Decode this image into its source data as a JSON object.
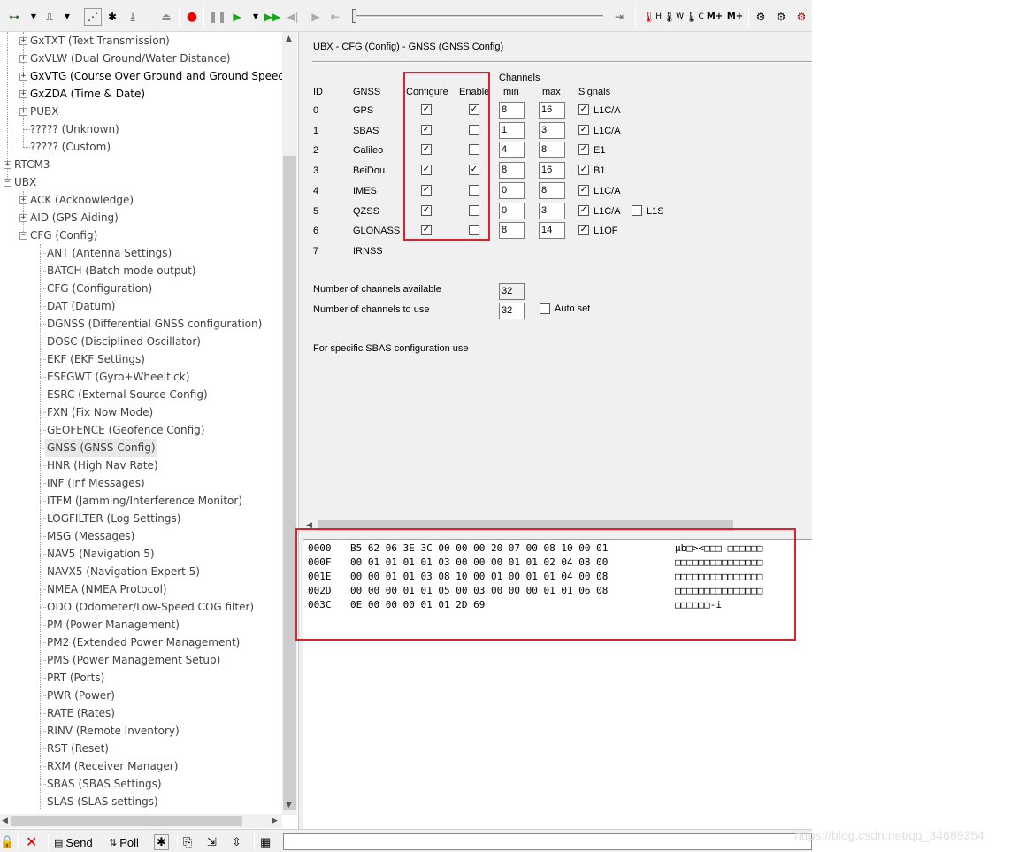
{
  "toolbar": {
    "icons": [
      "connect-icon",
      "baud-icon",
      "wizard-icon",
      "debug-icon",
      "download-icon",
      "eject-icon",
      "record-icon",
      "pause-icon",
      "play-icon",
      "fast-forward-icon",
      "step-back-icon",
      "step-forward-icon",
      "skip-start-icon",
      "skip-end-icon",
      "hot-start-icon",
      "warm-start-icon",
      "cold-start-icon",
      "msg-add-icon",
      "msg-remove-icon",
      "settings-icon",
      "settings-2-icon",
      "settings-3-icon"
    ],
    "labels": {
      "hot": "H",
      "warm": "W",
      "cold": "C"
    }
  },
  "tree": {
    "items": [
      {
        "label": "GxTXT (Text Transmission)",
        "exp": "+"
      },
      {
        "label": "GxVLW (Dual Ground/Water Distance)",
        "exp": "+"
      },
      {
        "label": "GxVTG (Course Over Ground and Ground Speed)",
        "exp": "+"
      },
      {
        "label": "GxZDA (Time & Date)",
        "exp": "+"
      },
      {
        "label": "PUBX",
        "exp": "+"
      },
      {
        "label": "????? (Unknown)",
        "exp": ""
      },
      {
        "label": "????? (Custom)",
        "exp": ""
      },
      {
        "label": "RTCM3",
        "exp": "+"
      },
      {
        "label": "UBX",
        "exp": "−"
      },
      {
        "label": "ACK (Acknowledge)",
        "exp": "+"
      },
      {
        "label": "AID (GPS Aiding)",
        "exp": "+"
      },
      {
        "label": "CFG (Config)",
        "exp": "−"
      },
      {
        "label": "ANT (Antenna Settings)"
      },
      {
        "label": "BATCH (Batch mode output)"
      },
      {
        "label": "CFG (Configuration)"
      },
      {
        "label": "DAT (Datum)"
      },
      {
        "label": "DGNSS (Differential GNSS configuration)"
      },
      {
        "label": "DOSC (Disciplined Oscillator)"
      },
      {
        "label": "EKF (EKF Settings)"
      },
      {
        "label": "ESFGWT (Gyro+Wheeltick)"
      },
      {
        "label": "ESRC (External Source Config)"
      },
      {
        "label": "FXN (Fix Now Mode)"
      },
      {
        "label": "GEOFENCE (Geofence Config)"
      },
      {
        "label": "GNSS (GNSS Config)"
      },
      {
        "label": "HNR (High Nav Rate)"
      },
      {
        "label": "INF (Inf Messages)"
      },
      {
        "label": "ITFM (Jamming/Interference Monitor)"
      },
      {
        "label": "LOGFILTER (Log Settings)"
      },
      {
        "label": "MSG (Messages)"
      },
      {
        "label": "NAV5 (Navigation 5)"
      },
      {
        "label": "NAVX5 (Navigation Expert 5)"
      },
      {
        "label": "NMEA (NMEA Protocol)"
      },
      {
        "label": "ODO (Odometer/Low-Speed COG filter)"
      },
      {
        "label": "PM (Power Management)"
      },
      {
        "label": "PM2 (Extended Power Management)"
      },
      {
        "label": "PMS (Power Management Setup)"
      },
      {
        "label": "PRT (Ports)"
      },
      {
        "label": "PWR (Power)"
      },
      {
        "label": "RATE (Rates)"
      },
      {
        "label": "RINV (Remote Inventory)"
      },
      {
        "label": "RST (Reset)"
      },
      {
        "label": "RXM (Receiver Manager)"
      },
      {
        "label": "SBAS (SBAS Settings)"
      },
      {
        "label": "SLAS (SLAS settings)"
      }
    ]
  },
  "panel": {
    "title": "UBX - CFG (Config) - GNSS (GNSS Config)",
    "headers": {
      "id": "ID",
      "gnss": "GNSS",
      "configure": "Configure",
      "enable": "Enable",
      "channels": "Channels",
      "min": "min",
      "max": "max",
      "signals": "Signals"
    },
    "rows": [
      {
        "id": "0",
        "gnss": "GPS",
        "configure": true,
        "enable": true,
        "min": "8",
        "max": "16",
        "signal": "L1C/A",
        "signal_checked": true,
        "extra": ""
      },
      {
        "id": "1",
        "gnss": "SBAS",
        "configure": true,
        "enable": false,
        "min": "1",
        "max": "3",
        "signal": "L1C/A",
        "signal_checked": true,
        "extra": ""
      },
      {
        "id": "2",
        "gnss": "Galileo",
        "configure": true,
        "enable": false,
        "min": "4",
        "max": "8",
        "signal": "E1",
        "signal_checked": true,
        "extra": ""
      },
      {
        "id": "3",
        "gnss": "BeiDou",
        "configure": true,
        "enable": true,
        "min": "8",
        "max": "16",
        "signal": "B1",
        "signal_checked": true,
        "extra": ""
      },
      {
        "id": "4",
        "gnss": "IMES",
        "configure": true,
        "enable": false,
        "min": "0",
        "max": "8",
        "signal": "L1C/A",
        "signal_checked": true,
        "extra": ""
      },
      {
        "id": "5",
        "gnss": "QZSS",
        "configure": true,
        "enable": false,
        "min": "0",
        "max": "3",
        "signal": "L1C/A",
        "signal_checked": true,
        "extra": "L1S"
      },
      {
        "id": "6",
        "gnss": "GLONASS",
        "configure": true,
        "enable": false,
        "min": "8",
        "max": "14",
        "signal": "L1OF",
        "signal_checked": true,
        "extra": ""
      },
      {
        "id": "7",
        "gnss": "IRNSS"
      }
    ],
    "channels_available_label": "Number of channels available",
    "channels_available": "32",
    "channels_use_label": "Number of channels to use",
    "channels_use": "32",
    "auto_set_label": "Auto set",
    "sbas_note": "For specific SBAS configuration use"
  },
  "hex": {
    "lines": [
      {
        "offset": "0000",
        "bytes": "B5 62 06 3E 3C 00 00 00 20 07 00 08 10 00 01",
        "ascii": "µb□><□□□ □□□□□□"
      },
      {
        "offset": "000F",
        "bytes": "00 01 01 01 01 03 00 00 00 01 01 02 04 08 00",
        "ascii": "□□□□□□□□□□□□□□□"
      },
      {
        "offset": "001E",
        "bytes": "00 00 01 01 03 08 10 00 01 00 01 01 04 00 08",
        "ascii": "□□□□□□□□□□□□□□□"
      },
      {
        "offset": "002D",
        "bytes": "00 00 00 01 01 05 00 03 00 00 00 01 01 06 08",
        "ascii": "□□□□□□□□□□□□□□□"
      },
      {
        "offset": "003C",
        "bytes": "0E 00 00 00 01 01 2D 69",
        "ascii": "□□□□□□-i"
      }
    ]
  },
  "bottombar": {
    "send_label": "Send",
    "poll_label": "Poll"
  },
  "watermark": "https://blog.csdn.net/qq_34689354",
  "colors": {
    "annotation_red": "#d9232e",
    "panel_bg": "#f0f0f0"
  }
}
